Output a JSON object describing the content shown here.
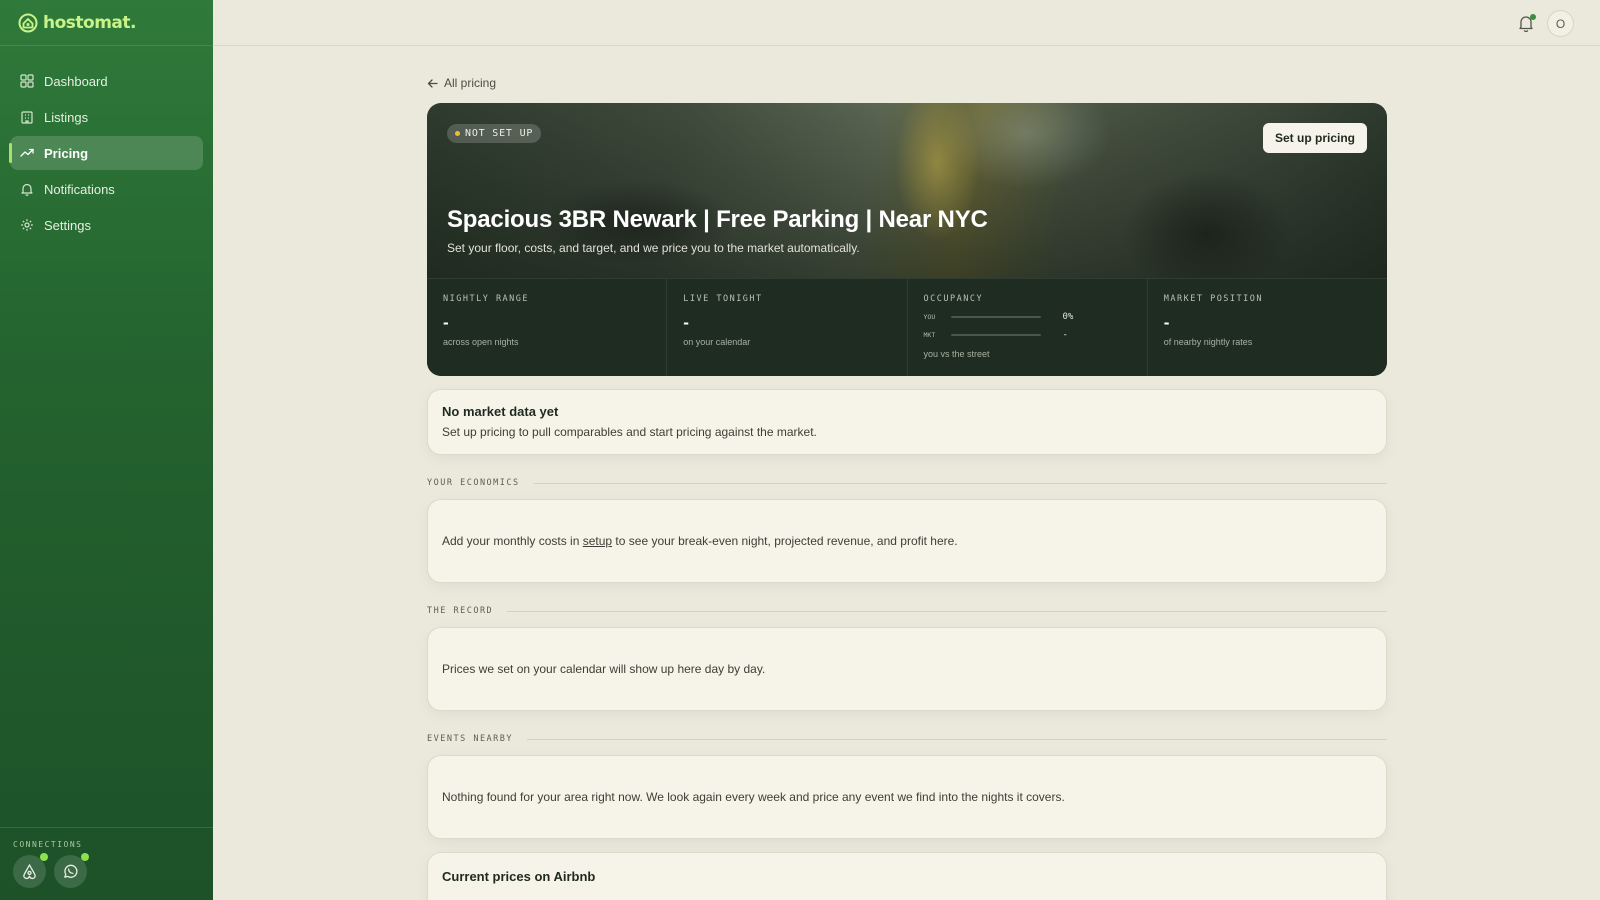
{
  "app": {
    "brand": "hostomat."
  },
  "sidebar": {
    "items": [
      {
        "label": "Dashboard",
        "icon": "grid-icon",
        "active": false
      },
      {
        "label": "Listings",
        "icon": "building-icon",
        "active": false
      },
      {
        "label": "Pricing",
        "icon": "trend-up-icon",
        "active": true
      },
      {
        "label": "Notifications",
        "icon": "bell-icon",
        "active": false
      },
      {
        "label": "Settings",
        "icon": "gear-icon",
        "active": false
      }
    ],
    "connections_label": "CONNECTIONS",
    "connections": [
      {
        "icon": "airbnb-icon",
        "connected": true
      },
      {
        "icon": "whatsapp-icon",
        "connected": true
      }
    ]
  },
  "topbar": {
    "avatar_initial": "O",
    "has_notification": true
  },
  "main": {
    "back_label": "All pricing",
    "hero": {
      "badge": "NOT SET UP",
      "setup_button": "Set up pricing",
      "title": "Spacious 3BR Newark | Free Parking | Near NYC",
      "subtitle": "Set your floor, costs, and target, and we price you to the market automatically.",
      "stats": {
        "nightly_range": {
          "label": "NIGHTLY RANGE",
          "value": "-",
          "note": "across open nights"
        },
        "live_tonight": {
          "label": "LIVE TONIGHT",
          "value": "-",
          "note": "on your calendar"
        },
        "occupancy": {
          "label": "OCCUPANCY",
          "you_label": "YOU",
          "you_value": "0%",
          "you_fraction": 0,
          "mkt_label": "MKT",
          "mkt_value": "-",
          "note": "you vs the street"
        },
        "market_position": {
          "label": "MARKET POSITION",
          "value": "-",
          "note": "of nearby nightly rates"
        }
      }
    },
    "no_market": {
      "title": "No market data yet",
      "text": "Set up pricing to pull comparables and start pricing against the market."
    },
    "economics": {
      "label": "YOUR ECONOMICS",
      "text_before": "Add your monthly costs in ",
      "link": "setup",
      "text_after": " to see your break-even night, projected revenue, and profit here."
    },
    "record": {
      "label": "THE RECORD",
      "text": "Prices we set on your calendar will show up here day by day."
    },
    "events": {
      "label": "EVENTS NEARBY",
      "text": "Nothing found for your area right now. We look again every week and price any event we find into the nights it covers."
    },
    "airbnb": {
      "title": "Current prices on Airbnb"
    }
  },
  "colors": {
    "accent": "#a8e26b",
    "sidebar": "#24632f",
    "badge_dot": "#f1b93b",
    "connected_dot": "#8ee14e"
  }
}
